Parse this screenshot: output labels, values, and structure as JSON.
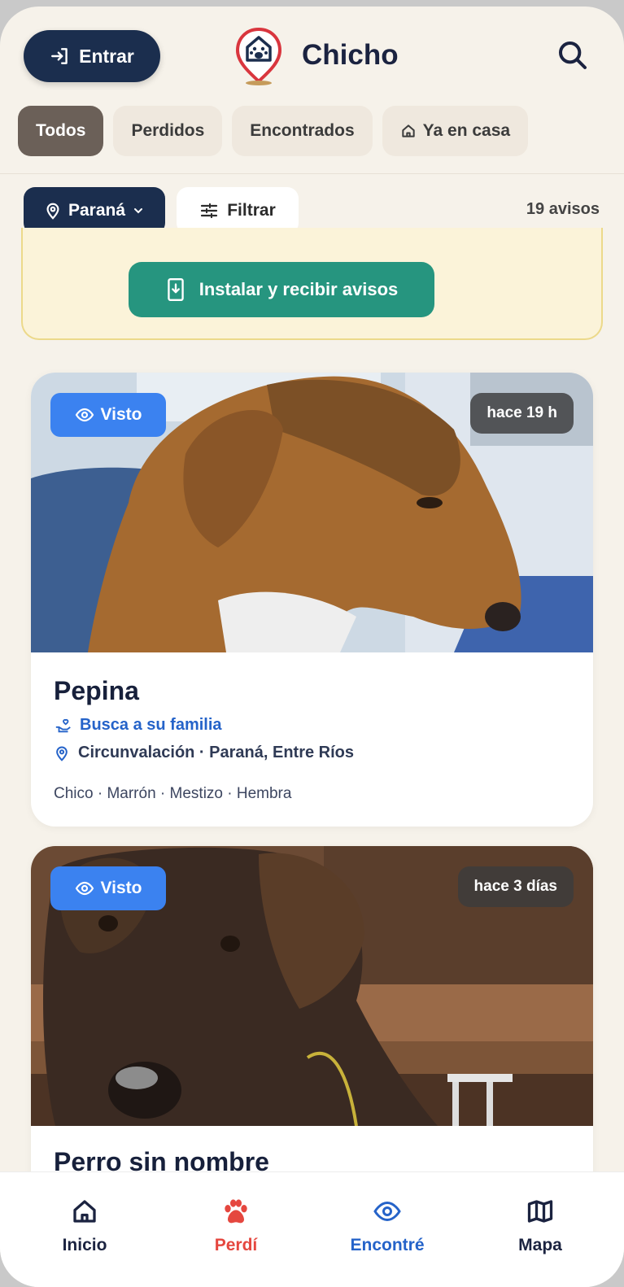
{
  "header": {
    "login_label": "Entrar",
    "app_title": "Chicho",
    "search_icon": "search-icon",
    "login_icon": "login-arrow-icon"
  },
  "tabs": [
    {
      "label": "Todos",
      "active": true
    },
    {
      "label": "Perdidos",
      "active": false
    },
    {
      "label": "Encontrados",
      "active": false
    },
    {
      "label": "Ya en casa",
      "active": false,
      "icon": "home-icon"
    }
  ],
  "filters": {
    "location_label": "Paraná",
    "filter_label": "Filtrar",
    "count_label": "19 avisos"
  },
  "banner": {
    "install_label": "Instalar y recibir avisos"
  },
  "posts": [
    {
      "badge": "Visto",
      "time": "hace 19 h",
      "name": "Pepina",
      "status": "Busca a su familia",
      "location": "Circunvalación · Paraná, Entre Ríos",
      "traits": "Chico · Marrón · Mestizo · Hembra"
    },
    {
      "badge": "Visto",
      "time": "hace 3 días",
      "name": "Perro sin nombre"
    }
  ],
  "nav": {
    "home": "Inicio",
    "lost": "Perdí",
    "found": "Encontré",
    "map": "Mapa"
  },
  "colors": {
    "navy": "#1b2e4e",
    "accent_green": "#26957f",
    "seen_blue": "#3b82f0",
    "lost_red": "#e5473f"
  }
}
